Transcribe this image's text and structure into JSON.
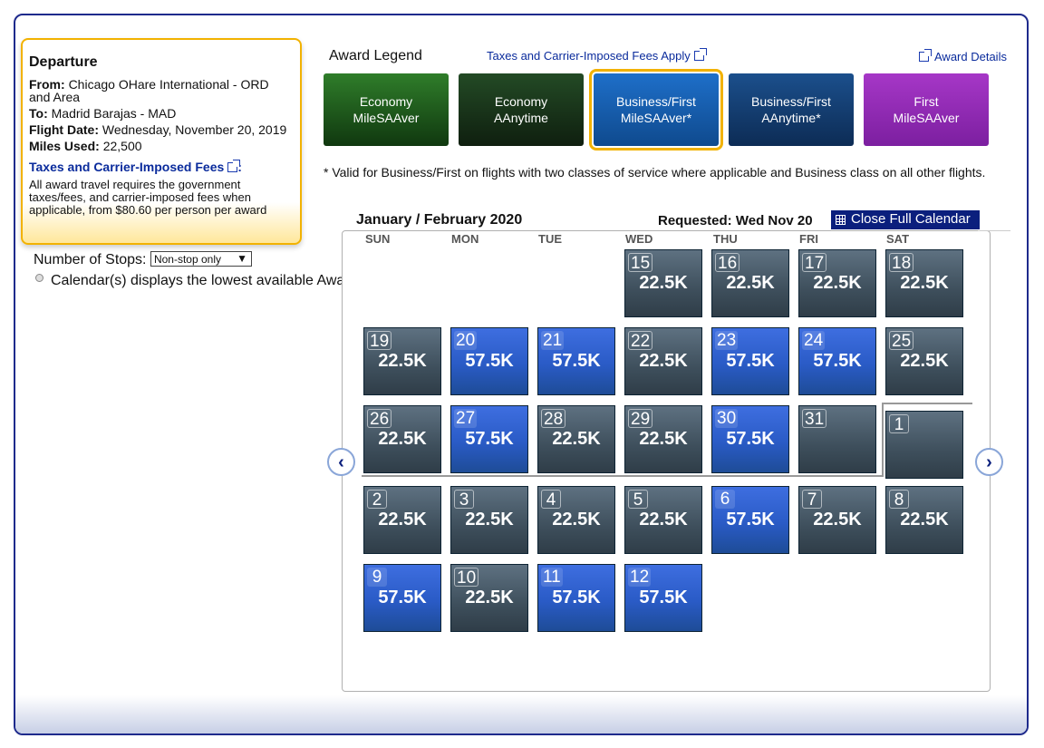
{
  "departure": {
    "title": "Departure",
    "from_label": "From:",
    "from_value": "Chicago OHare International - ORD and Area",
    "to_label": "To:",
    "to_value": "Madrid Barajas - MAD",
    "date_label": "Flight Date:",
    "date_value": "Wednesday, November 20, 2019",
    "miles_label": "Miles Used:",
    "miles_value": "22,500",
    "fees_link": "Taxes and Carrier-Imposed Fees",
    "fees_colon": ":",
    "fees_text": "All award travel requires the government taxes/fees, and carrier-imposed fees when applicable, from $80.60 per person per award"
  },
  "stops": {
    "label": "Number of Stops:",
    "selected": "Non-stop only",
    "arrow": "▼"
  },
  "calendar_note": "Calendar(s) displays the lowest available Award Miles for that day",
  "legend": {
    "title": "Award Legend",
    "taxes_link": "Taxes and Carrier-Imposed Fees Apply",
    "details_link": "Award Details",
    "items": [
      {
        "line1": "Economy",
        "line2": "MileSAAver"
      },
      {
        "line1": "Economy",
        "line2": "AAnytime"
      },
      {
        "line1": "Business/First",
        "line2": "MileSAAver*"
      },
      {
        "line1": "Business/First",
        "line2": "AAnytime*"
      },
      {
        "line1": "First",
        "line2": "MileSAAver"
      }
    ]
  },
  "valid_note": "* Valid for Business/First on flights with two classes of service where applicable and Business class on all other flights.",
  "calendar": {
    "month_title": "January / February 2020",
    "requested": "Requested: Wed Nov 20",
    "close_button": "Close Full Calendar",
    "days_of_week": [
      "SUN",
      "MON",
      "TUE",
      "WED",
      "THU",
      "FRI",
      "SAT"
    ],
    "prev_icon": "‹",
    "next_icon": "›",
    "weeks": [
      [
        null,
        null,
        null,
        {
          "day": "15",
          "miles": "22.5K",
          "type": "gray"
        },
        {
          "day": "16",
          "miles": "22.5K",
          "type": "gray"
        },
        {
          "day": "17",
          "miles": "22.5K",
          "type": "gray"
        },
        {
          "day": "18",
          "miles": "22.5K",
          "type": "gray"
        }
      ],
      [
        {
          "day": "19",
          "miles": "22.5K",
          "type": "gray"
        },
        {
          "day": "20",
          "miles": "57.5K",
          "type": "blue"
        },
        {
          "day": "21",
          "miles": "57.5K",
          "type": "blue"
        },
        {
          "day": "22",
          "miles": "22.5K",
          "type": "gray"
        },
        {
          "day": "23",
          "miles": "57.5K",
          "type": "blue"
        },
        {
          "day": "24",
          "miles": "57.5K",
          "type": "blue"
        },
        {
          "day": "25",
          "miles": "22.5K",
          "type": "gray"
        }
      ],
      [
        {
          "day": "26",
          "miles": "22.5K",
          "type": "gray"
        },
        {
          "day": "27",
          "miles": "57.5K",
          "type": "blue"
        },
        {
          "day": "28",
          "miles": "22.5K",
          "type": "gray"
        },
        {
          "day": "29",
          "miles": "22.5K",
          "type": "gray"
        },
        {
          "day": "30",
          "miles": "57.5K",
          "type": "blue"
        },
        {
          "day": "31",
          "miles": "",
          "type": "gray"
        },
        {
          "day": "1",
          "miles": "",
          "type": "gray"
        }
      ],
      [
        {
          "day": "2",
          "miles": "22.5K",
          "type": "gray"
        },
        {
          "day": "3",
          "miles": "22.5K",
          "type": "gray"
        },
        {
          "day": "4",
          "miles": "22.5K",
          "type": "gray"
        },
        {
          "day": "5",
          "miles": "22.5K",
          "type": "gray"
        },
        {
          "day": "6",
          "miles": "57.5K",
          "type": "blue"
        },
        {
          "day": "7",
          "miles": "22.5K",
          "type": "gray"
        },
        {
          "day": "8",
          "miles": "22.5K",
          "type": "gray"
        }
      ],
      [
        {
          "day": "9",
          "miles": "57.5K",
          "type": "blue"
        },
        {
          "day": "10",
          "miles": "22.5K",
          "type": "gray"
        },
        {
          "day": "11",
          "miles": "57.5K",
          "type": "blue"
        },
        {
          "day": "12",
          "miles": "57.5K",
          "type": "blue"
        },
        null,
        null,
        null
      ]
    ]
  }
}
